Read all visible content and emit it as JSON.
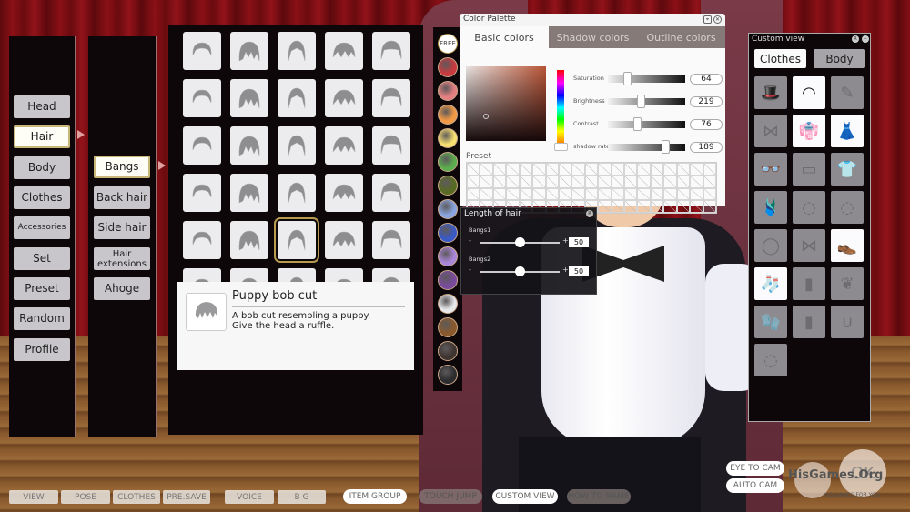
{
  "main_menu": {
    "items": [
      {
        "label": "Head",
        "active": false
      },
      {
        "label": "Hair",
        "active": true
      },
      {
        "label": "Body",
        "active": false
      },
      {
        "label": "Clothes",
        "active": false
      },
      {
        "label": "Accessories",
        "active": false
      },
      {
        "label": "Set",
        "active": false
      },
      {
        "label": "Preset",
        "active": false
      },
      {
        "label": "Random",
        "active": false
      },
      {
        "label": "Profile",
        "active": false
      }
    ]
  },
  "sub_menu": {
    "items": [
      {
        "label": "Bangs",
        "active": true
      },
      {
        "label": "Back hair",
        "active": false
      },
      {
        "label": "Side hair",
        "active": false
      },
      {
        "label": "Hair extensions",
        "active": false
      },
      {
        "label": "Ahoge",
        "active": false
      }
    ]
  },
  "hair_grid": {
    "columns": 5,
    "rows_visible": 6,
    "selected_index": 22,
    "tile_icon": "hair-bangs-thumbnail"
  },
  "tooltip": {
    "title": "Puppy bob cut",
    "description_line1": "A bob cut resembling a puppy.",
    "description_line2": "Give the head a ruffle."
  },
  "swatches": {
    "free_label": "FREE",
    "colors": [
      "#c83a3e",
      "#e47f82",
      "#f29a45",
      "#f7e070",
      "#5cad4e",
      "#586a22",
      "#8aa6e0",
      "#3a5ac8",
      "#a986d8",
      "#7a4a9e",
      "#e6e8ea",
      "#8a5a2c",
      "#3e3430",
      "#2c2c2e"
    ]
  },
  "color_palette": {
    "title": "Color Palette",
    "tabs": [
      {
        "label": "Basic colors",
        "active": true
      },
      {
        "label": "Shadow colors",
        "active": false
      },
      {
        "label": "Outline colors",
        "active": false
      }
    ],
    "sliders": [
      {
        "label": "Saturation",
        "value": "64",
        "fraction": 0.25
      },
      {
        "label": "Brightness",
        "value": "219",
        "fraction": 0.42
      },
      {
        "label": "Contrast",
        "value": "76",
        "fraction": 0.38
      },
      {
        "label": "shadow rate",
        "value": "189",
        "fraction": 0.74
      }
    ],
    "preset_label": "Preset",
    "preset_columns": 19,
    "preset_rows": 4,
    "base_color": "#b85436"
  },
  "length_of_hair": {
    "title": "Length of hair",
    "rows": [
      {
        "label": "Bangs1",
        "value": "50",
        "fraction": 0.5
      },
      {
        "label": "Bangs2",
        "value": "50",
        "fraction": 0.5
      }
    ],
    "minus": "-",
    "plus": "+"
  },
  "custom_view": {
    "title": "Custom view",
    "tabs": [
      {
        "label": "Clothes",
        "active": true
      },
      {
        "label": "Body",
        "active": false
      }
    ],
    "items": [
      {
        "icon": "hat-icon",
        "glyph": "🎩",
        "on": false
      },
      {
        "icon": "headband-icon",
        "glyph": "◠",
        "on": true
      },
      {
        "icon": "hairpin-icon",
        "glyph": "✎",
        "on": false
      },
      {
        "icon": "ribbon-icon",
        "glyph": "⋈",
        "on": false
      },
      {
        "icon": "maid-top-icon",
        "glyph": "👘",
        "on": true
      },
      {
        "icon": "apron-skirt-icon",
        "glyph": "👗",
        "on": true
      },
      {
        "icon": "glasses-icon",
        "glyph": "👓",
        "on": false
      },
      {
        "icon": "eye-mask-icon",
        "glyph": "▭",
        "on": false
      },
      {
        "icon": "bodysuit-icon",
        "glyph": "👕",
        "on": false
      },
      {
        "icon": "swimsuit-icon",
        "glyph": "🩱",
        "on": false
      },
      {
        "icon": "earring-icon",
        "glyph": "◌",
        "on": false
      },
      {
        "icon": "earring-side-icon",
        "glyph": "◌",
        "on": false
      },
      {
        "icon": "necklace-icon",
        "glyph": "◯",
        "on": false
      },
      {
        "icon": "bowtie-icon",
        "glyph": "⋈",
        "on": false
      },
      {
        "icon": "shoes-icon",
        "glyph": "👞",
        "on": true
      },
      {
        "icon": "stockings-icon",
        "glyph": "🧦",
        "on": true
      },
      {
        "icon": "armband-icon",
        "glyph": "▮",
        "on": false
      },
      {
        "icon": "wings-icon",
        "glyph": "❦",
        "on": false
      },
      {
        "icon": "gloves-icon",
        "glyph": "🧤",
        "on": false
      },
      {
        "icon": "wristbands-icon",
        "glyph": "▮",
        "on": false
      },
      {
        "icon": "tail-icon",
        "glyph": "∪",
        "on": false
      },
      {
        "icon": "navel-ring-icon",
        "glyph": "◌",
        "on": false
      }
    ]
  },
  "bottom_bar": {
    "left_buttons": [
      "VIEW",
      "POSE",
      "CLOTHES",
      "PRE.SAVE",
      "VOICE",
      "B G"
    ],
    "pills": [
      {
        "label": "ITEM GROUP",
        "style": "white"
      },
      {
        "label": "TOUCH JUMP",
        "style": "dim"
      },
      {
        "label": "CUSTOM VIEW",
        "style": "white"
      },
      {
        "label": "HOW TO NAME",
        "style": "dim"
      }
    ],
    "cam_buttons": [
      "EYE TO CAM",
      "AUTO CAM"
    ],
    "ok_label": "OK"
  },
  "watermark": {
    "text": "HisGames.Org",
    "subtext": "HIS GAMES FOR YOU"
  }
}
